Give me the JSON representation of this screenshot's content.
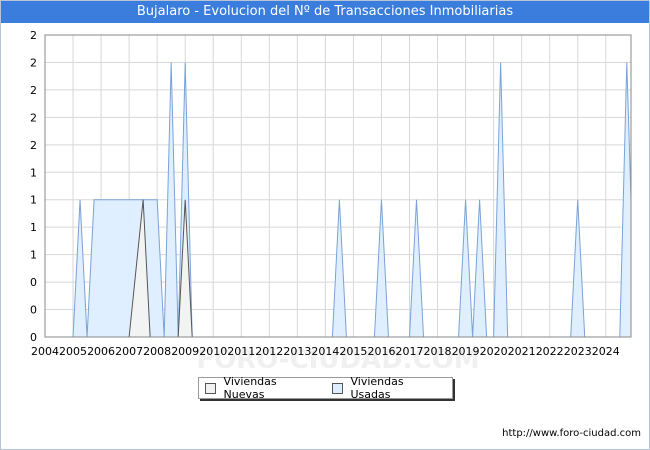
{
  "page": {
    "title": "Bujalaro - Evolucion del Nº de Transacciones Inmobiliarias",
    "watermark": "FORO-CIUDAD.COM",
    "footer_url": "http://www.foro-ciudad.com"
  },
  "colors": {
    "title_bg": "#3b7ddd",
    "usadas_fill": "#ddeeff",
    "usadas_stroke": "#7aa3d6",
    "nuevas_fill": "#f2f2f2",
    "nuevas_stroke": "#555555",
    "grid": "#d8d8d8"
  },
  "legend": {
    "nuevas_label": "Viviendas Nuevas",
    "usadas_label": "Viviendas Usadas"
  },
  "chart_data": {
    "type": "area",
    "title": "Bujalaro - Evolucion del Nº de Transacciones Inmobiliarias",
    "xlabel": "",
    "ylabel": "",
    "xlim": [
      2004,
      2024.9
    ],
    "ylim": [
      0,
      2.2
    ],
    "x_ticks": [
      "2004",
      "2005",
      "2006",
      "2007",
      "2008",
      "2009",
      "2010",
      "2011",
      "2012",
      "2013",
      "2014",
      "2015",
      "2016",
      "2017",
      "2018",
      "2019",
      "2020",
      "2021",
      "2022",
      "2023",
      "2024"
    ],
    "y_ticks": [
      {
        "value": 0,
        "label": "0"
      },
      {
        "value": 0.2,
        "label": "0"
      },
      {
        "value": 0.4,
        "label": "0"
      },
      {
        "value": 0.6,
        "label": "1"
      },
      {
        "value": 0.8,
        "label": "1"
      },
      {
        "value": 1.0,
        "label": "1"
      },
      {
        "value": 1.2,
        "label": "1"
      },
      {
        "value": 1.4,
        "label": "2"
      },
      {
        "value": 1.6,
        "label": "2"
      },
      {
        "value": 1.8,
        "label": "2"
      },
      {
        "value": 2.0,
        "label": "2"
      },
      {
        "value": 2.2,
        "label": "2"
      }
    ],
    "grid": true,
    "legend_position": "bottom-center",
    "series": [
      {
        "name": "Viviendas Usadas",
        "points": [
          [
            2005.0,
            0
          ],
          [
            2005.25,
            1
          ],
          [
            2005.5,
            0
          ],
          [
            2005.75,
            1
          ],
          [
            2006.0,
            1
          ],
          [
            2006.25,
            1
          ],
          [
            2006.5,
            1
          ],
          [
            2006.75,
            1
          ],
          [
            2007.0,
            1
          ],
          [
            2007.25,
            1
          ],
          [
            2007.5,
            1
          ],
          [
            2007.75,
            1
          ],
          [
            2008.0,
            1
          ],
          [
            2008.25,
            0
          ],
          [
            2008.5,
            2
          ],
          [
            2008.75,
            0
          ],
          [
            2009.0,
            2
          ],
          [
            2009.25,
            0
          ],
          [
            2014.25,
            0
          ],
          [
            2014.5,
            1
          ],
          [
            2014.75,
            0
          ],
          [
            2015.75,
            0
          ],
          [
            2016.0,
            1
          ],
          [
            2016.25,
            0
          ],
          [
            2017.0,
            0
          ],
          [
            2017.25,
            1
          ],
          [
            2017.5,
            0
          ],
          [
            2018.75,
            0
          ],
          [
            2019.0,
            1
          ],
          [
            2019.25,
            0
          ],
          [
            2019.5,
            1
          ],
          [
            2019.75,
            0
          ],
          [
            2020.0,
            0
          ],
          [
            2020.25,
            2
          ],
          [
            2020.5,
            0
          ],
          [
            2022.75,
            0
          ],
          [
            2023.0,
            1
          ],
          [
            2023.25,
            0
          ],
          [
            2024.5,
            0
          ],
          [
            2024.75,
            2
          ],
          [
            2024.9,
            1
          ]
        ]
      },
      {
        "name": "Viviendas Nuevas",
        "points": [
          [
            2007.0,
            0
          ],
          [
            2007.5,
            1
          ],
          [
            2007.75,
            0
          ],
          [
            2008.75,
            0
          ],
          [
            2009.0,
            1
          ],
          [
            2009.25,
            0
          ]
        ]
      }
    ]
  }
}
